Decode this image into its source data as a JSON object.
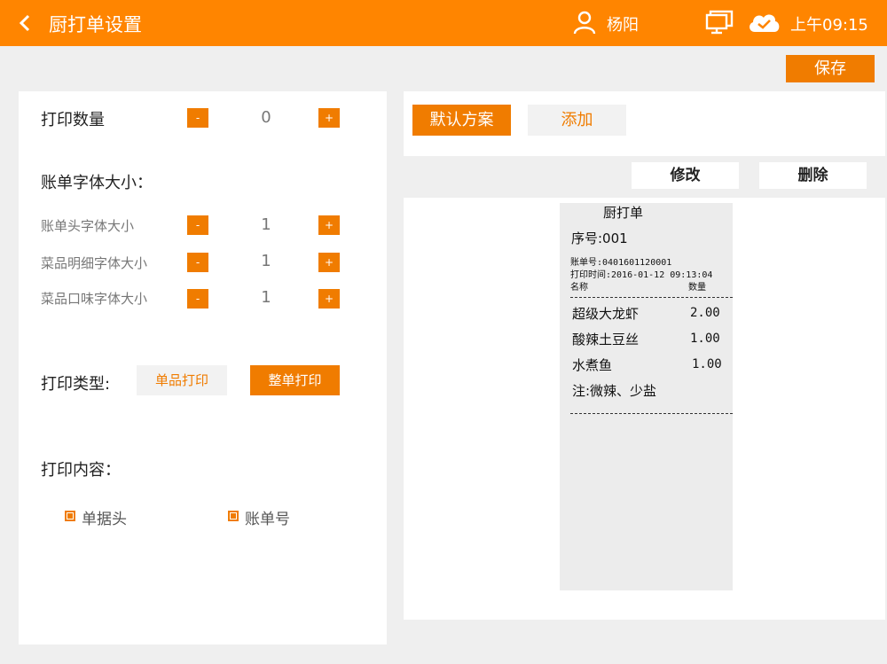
{
  "header": {
    "title": "厨打单设置",
    "user_name": "杨阳",
    "time": "上午09:15"
  },
  "toolbar": {
    "save_label": "保存"
  },
  "left": {
    "print_count": {
      "label": "打印数量",
      "value": "0",
      "minus": "-",
      "plus": "+"
    },
    "font_size_section": "账单字体大小：",
    "font_sizes": [
      {
        "label": "账单头字体大小",
        "value": "1"
      },
      {
        "label": "菜品明细字体大小",
        "value": "1"
      },
      {
        "label": "菜品口味字体大小",
        "value": "1"
      }
    ],
    "step_minus": "-",
    "step_plus": "+",
    "print_type": {
      "label": "打印类型:",
      "single": "单品打印",
      "whole": "整单打印",
      "selected": "整单打印"
    },
    "print_content": {
      "label": "打印内容：",
      "options": [
        {
          "label": "单据头",
          "checked": true
        },
        {
          "label": "账单号",
          "checked": true
        }
      ]
    }
  },
  "schemes": {
    "default": "默认方案",
    "add": "添加"
  },
  "actions": {
    "edit": "修改",
    "delete": "删除"
  },
  "receipt": {
    "title": "厨打单",
    "seq": "序号:001",
    "bill_no": "账单号:0401601120001",
    "print_time": "打印时间:2016-01-12 09:13:04",
    "col_name": "名称",
    "col_qty": "数量",
    "items": [
      {
        "name": "超级大龙虾",
        "qty": "2.00"
      },
      {
        "name": "酸辣土豆丝",
        "qty": "1.00"
      },
      {
        "name": "水煮鱼",
        "qty": "1.00"
      }
    ],
    "note": "注:微辣、少盐"
  },
  "colors": {
    "accent": "#ff8500",
    "button": "#f07c00"
  }
}
